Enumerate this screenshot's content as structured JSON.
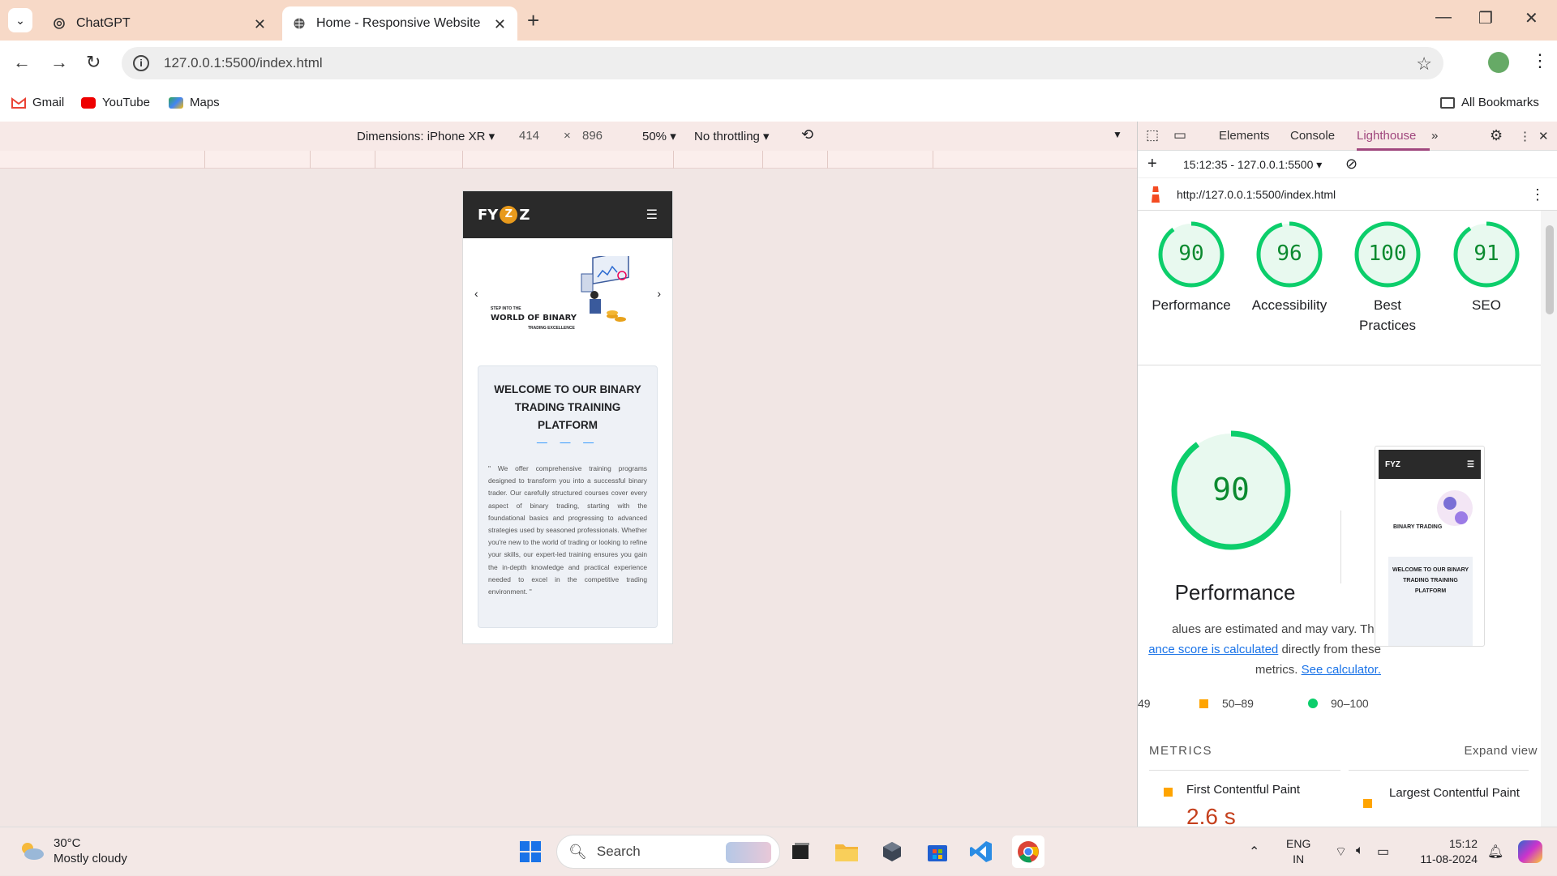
{
  "browser": {
    "tabs": [
      {
        "title": "ChatGPT"
      },
      {
        "title": "Home - Responsive Website"
      }
    ],
    "url": "127.0.0.1:5500/index.html",
    "bookmarks": [
      {
        "label": "Gmail"
      },
      {
        "label": "YouTube"
      },
      {
        "label": "Maps"
      }
    ],
    "all_bookmarks": "All Bookmarks"
  },
  "device_toolbar": {
    "dimensions": "Dimensions: iPhone XR",
    "width": "414",
    "times": "×",
    "height": "896",
    "zoom": "50%",
    "throttling": "No throttling"
  },
  "site": {
    "logo": "FY",
    "logo_coin": "Z",
    "logo_end": "Z",
    "hero_small": "STEP INTO THE",
    "hero_big": "WORLD OF BINARY",
    "hero_sub": "TRADING EXCELLENCE",
    "card_title": "WELCOME TO OUR BINARY TRADING TRAINING PLATFORM",
    "card_dashes": "— — —",
    "card_body": "\" We offer comprehensive training programs designed to transform you into a successful binary trader. Our carefully structured courses cover every aspect of binary trading, starting with the foundational basics and progressing to advanced strategies used by seasoned professionals. Whether you're new to the world of trading or looking to refine your skills, our expert-led training ensures you gain the in-depth knowledge and practical experience needed to excel in the competitive trading environment. \""
  },
  "devtools": {
    "tabs": [
      {
        "label": "Elements"
      },
      {
        "label": "Console"
      },
      {
        "label": "Lighthouse"
      }
    ],
    "report_select": "15:12:35 - 127.0.0.1:5500",
    "report_url": "http://127.0.0.1:5500/index.html",
    "scores": [
      {
        "label": "Performance",
        "value": "90",
        "fraction": 0.9
      },
      {
        "label": "Accessibility",
        "value": "96",
        "fraction": 0.96
      },
      {
        "label": "Best Practices",
        "value": "100",
        "fraction": 1.0
      },
      {
        "label": "SEO",
        "value": "91",
        "fraction": 0.91
      }
    ],
    "perf_title": "Performance",
    "perf_big": "90",
    "note_1": "alues are estimated and may vary. The",
    "note_link": "ance score is calculated",
    "note_2": "directly from these",
    "note_3": "metrics.",
    "note_calc": "See calculator.",
    "legend": [
      "49",
      "50–89",
      "90–100"
    ],
    "metrics_heading": "METRICS",
    "expand_view": "Expand view",
    "metric1_label": "First Contentful Paint",
    "metric1_value": "2.6 s",
    "metric2_label": "Largest Contentful Paint",
    "thumb_logo": "FYZ",
    "thumb_title": "WELCOME TO OUR BINARY TRADING TRAINING PLATFORM",
    "thumb_hero": "BINARY TRADING",
    "colors": {
      "pass": "#0cce6b",
      "average": "#ffa400",
      "fail_text": "#c5401d"
    }
  },
  "taskbar": {
    "temp": "30°C",
    "weather": "Mostly cloudy",
    "search": "Search",
    "lang1": "ENG",
    "lang2": "IN",
    "time": "15:12",
    "date": "11-08-2024"
  }
}
